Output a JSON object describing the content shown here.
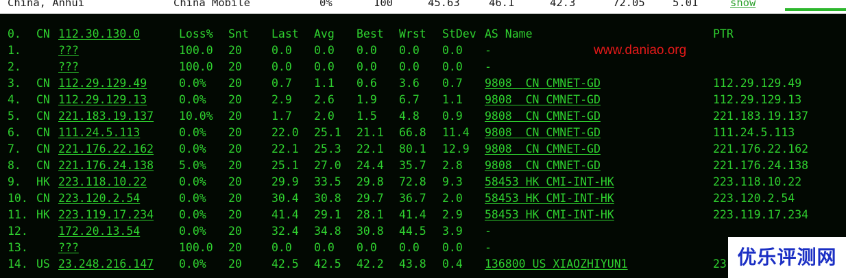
{
  "top_row": {
    "location": "China, Anhui",
    "isp": "China Mobile",
    "loss": "0%",
    "count": "100",
    "v1": "45.63",
    "v2": "46.1",
    "v3": "42.3",
    "v4": "72.05",
    "v5": "5.01",
    "show": "show"
  },
  "header": {
    "num": "0.",
    "cc": "CN",
    "host": "112.30.130.0",
    "loss": "Loss%",
    "snt": "Snt",
    "last": "Last",
    "avg": "Avg",
    "best": "Best",
    "wrst": "Wrst",
    "stdev": "StDev",
    "as": "AS Name",
    "ptr": "PTR"
  },
  "rows": [
    {
      "num": "1.",
      "cc": "",
      "host": "???",
      "loss": "100.0",
      "snt": "20",
      "last": "0.0",
      "avg": "0.0",
      "best": "0.0",
      "wrst": "0.0",
      "stdev": "0.0",
      "as": "-",
      "ptr": ""
    },
    {
      "num": "2.",
      "cc": "",
      "host": "???",
      "loss": "100.0",
      "snt": "20",
      "last": "0.0",
      "avg": "0.0",
      "best": "0.0",
      "wrst": "0.0",
      "stdev": "0.0",
      "as": "-",
      "ptr": ""
    },
    {
      "num": "3.",
      "cc": "CN",
      "host": "112.29.129.49",
      "loss": "0.0%",
      "snt": "20",
      "last": "0.7",
      "avg": "1.1",
      "best": "0.6",
      "wrst": "3.6",
      "stdev": "0.7",
      "as": "9808  CN CMNET-GD",
      "ptr": "112.29.129.49"
    },
    {
      "num": "4.",
      "cc": "CN",
      "host": "112.29.129.13",
      "loss": "0.0%",
      "snt": "20",
      "last": "2.9",
      "avg": "2.6",
      "best": "1.9",
      "wrst": "6.7",
      "stdev": "1.1",
      "as": "9808  CN CMNET-GD",
      "ptr": "112.29.129.13"
    },
    {
      "num": "5.",
      "cc": "CN",
      "host": "221.183.19.137",
      "loss": "10.0%",
      "snt": "20",
      "last": "1.7",
      "avg": "2.0",
      "best": "1.5",
      "wrst": "4.8",
      "stdev": "0.9",
      "as": "9808  CN CMNET-GD",
      "ptr": "221.183.19.137"
    },
    {
      "num": "6.",
      "cc": "CN",
      "host": "111.24.5.113",
      "loss": "0.0%",
      "snt": "20",
      "last": "22.0",
      "avg": "25.1",
      "best": "21.1",
      "wrst": "66.8",
      "stdev": "11.4",
      "as": "9808  CN CMNET-GD",
      "ptr": "111.24.5.113"
    },
    {
      "num": "7.",
      "cc": "CN",
      "host": "221.176.22.162",
      "loss": "0.0%",
      "snt": "20",
      "last": "22.1",
      "avg": "25.3",
      "best": "22.1",
      "wrst": "80.1",
      "stdev": "12.9",
      "as": "9808  CN CMNET-GD",
      "ptr": "221.176.22.162"
    },
    {
      "num": "8.",
      "cc": "CN",
      "host": "221.176.24.138",
      "loss": "5.0%",
      "snt": "20",
      "last": "25.1",
      "avg": "27.0",
      "best": "24.4",
      "wrst": "35.7",
      "stdev": "2.8",
      "as": "9808  CN CMNET-GD",
      "ptr": "221.176.24.138"
    },
    {
      "num": "9.",
      "cc": "HK",
      "host": "223.118.10.22",
      "loss": "0.0%",
      "snt": "20",
      "last": "29.9",
      "avg": "33.5",
      "best": "29.8",
      "wrst": "72.8",
      "stdev": "9.3",
      "as": "58453 HK CMI-INT-HK",
      "ptr": "223.118.10.22"
    },
    {
      "num": "10.",
      "cc": "CN",
      "host": "223.120.2.54",
      "loss": "0.0%",
      "snt": "20",
      "last": "30.4",
      "avg": "30.8",
      "best": "29.7",
      "wrst": "36.7",
      "stdev": "2.0",
      "as": "58453 HK CMI-INT-HK",
      "ptr": "223.120.2.54"
    },
    {
      "num": "11.",
      "cc": "HK",
      "host": "223.119.17.234",
      "loss": "0.0%",
      "snt": "20",
      "last": "41.4",
      "avg": "29.1",
      "best": "28.1",
      "wrst": "41.4",
      "stdev": "2.9",
      "as": "58453 HK CMI-INT-HK",
      "ptr": "223.119.17.234"
    },
    {
      "num": "12.",
      "cc": "",
      "host": "172.20.13.54",
      "loss": "0.0%",
      "snt": "20",
      "last": "32.4",
      "avg": "34.8",
      "best": "30.8",
      "wrst": "44.5",
      "stdev": "3.9",
      "as": "-",
      "ptr": ""
    },
    {
      "num": "13.",
      "cc": "",
      "host": "???",
      "loss": "100.0",
      "snt": "20",
      "last": "0.0",
      "avg": "0.0",
      "best": "0.0",
      "wrst": "0.0",
      "stdev": "0.0",
      "as": "-",
      "ptr": ""
    },
    {
      "num": "14.",
      "cc": "US",
      "host": "23.248.216.147",
      "loss": "0.0%",
      "snt": "20",
      "last": "42.5",
      "avg": "42.5",
      "best": "42.2",
      "wrst": "43.8",
      "stdev": "0.4",
      "as": "136800 US XIAOZHIYUN1",
      "ptr": "23"
    }
  ],
  "watermark": "www.daniao.org",
  "logo": "优乐评测网",
  "colors": {
    "terminal_bg": "#020802",
    "terminal_text": "#2fd12f",
    "watermark": "#e61919",
    "logo": "#1b2fc4"
  }
}
